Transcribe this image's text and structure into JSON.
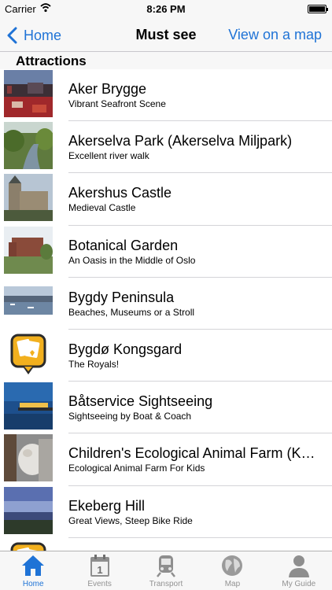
{
  "status_bar": {
    "carrier": "Carrier",
    "time": "8:26 PM"
  },
  "nav": {
    "back_label": "Home",
    "title": "Must see",
    "right_label": "View on a map"
  },
  "section": {
    "title": "Attractions"
  },
  "items": [
    {
      "title": "Aker Brygge",
      "subtitle": "Vibrant Seafront Scene",
      "thumb": "harbor-photo"
    },
    {
      "title": "Akerselva Park (Akerselva Miljpark)",
      "subtitle": "Excellent river walk",
      "thumb": "river-photo"
    },
    {
      "title": "Akershus Castle",
      "subtitle": "Medieval Castle",
      "thumb": "castle-photo"
    },
    {
      "title": "Botanical Garden",
      "subtitle": "An Oasis in the Middle of Oslo",
      "thumb": "garden-photo"
    },
    {
      "title": "Bygdy Peninsula",
      "subtitle": "Beaches, Museums or a Stroll",
      "thumb": "peninsula-photo"
    },
    {
      "title": "Bygdø Kongsgard",
      "subtitle": "The Royals!",
      "thumb": "placeholder-icon"
    },
    {
      "title": "Båtservice Sightseeing",
      "subtitle": "Sightseeing by Boat & Coach",
      "thumb": "boat-photo"
    },
    {
      "title": "Children's Ecological Animal Farm (Kampen Økologisk Barnebondegård)",
      "subtitle": "Ecological Animal Farm For Kids",
      "thumb": "goat-photo"
    },
    {
      "title": "Ekeberg Hill",
      "subtitle": "Great Views, Steep Bike Ride",
      "thumb": "hill-photo"
    },
    {
      "title": "",
      "subtitle": "",
      "thumb": "placeholder-icon"
    }
  ],
  "tabs": [
    {
      "label": "Home",
      "icon": "home-icon",
      "active": true
    },
    {
      "label": "Events",
      "icon": "calendar-icon",
      "active": false
    },
    {
      "label": "Transport",
      "icon": "train-icon",
      "active": false
    },
    {
      "label": "Map",
      "icon": "globe-icon",
      "active": false
    },
    {
      "label": "My Guide",
      "icon": "person-icon",
      "active": false
    }
  ],
  "colors": {
    "accent": "#1f73d6",
    "inactive": "#929292",
    "placeholder_badge": "#f2b01e"
  }
}
